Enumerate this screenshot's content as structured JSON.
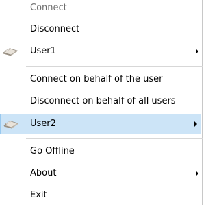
{
  "menu": {
    "items": [
      {
        "label": "Connect",
        "state": "disabled"
      },
      {
        "label": "Disconnect"
      },
      {
        "label": "User1",
        "icon": "user-device-icon",
        "submenu": true
      },
      {
        "label": "Connect on behalf of the user"
      },
      {
        "label": "Disconnect on behalf of all users"
      },
      {
        "label": "User2",
        "icon": "user-device-icon",
        "submenu": true,
        "state": "highlighted"
      },
      {
        "label": "Go Offline"
      },
      {
        "label": "About",
        "submenu": true
      },
      {
        "label": "Exit"
      }
    ]
  },
  "colors": {
    "highlight_fill": "#cce4f7",
    "highlight_border": "#99c9ef",
    "disabled_text": "#6d6d6d",
    "separator": "#d7d7d7"
  }
}
